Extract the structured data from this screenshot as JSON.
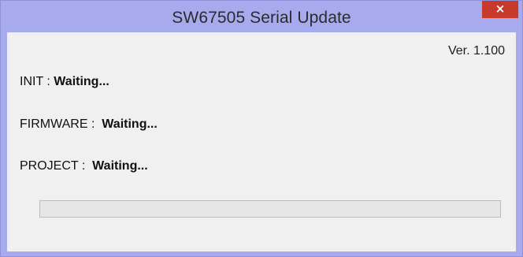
{
  "window": {
    "title": "SW67505 Serial Update",
    "close_label": "×"
  },
  "version": "Ver. 1.100",
  "status": [
    {
      "label": "INIT",
      "sep": " : ",
      "value": "Waiting..."
    },
    {
      "label": "FIRMWARE",
      "sep": " :  ",
      "value": "Waiting..."
    },
    {
      "label": "PROJECT",
      "sep": " :  ",
      "value": "Waiting..."
    }
  ],
  "progress": {
    "fraction": 0.0
  }
}
